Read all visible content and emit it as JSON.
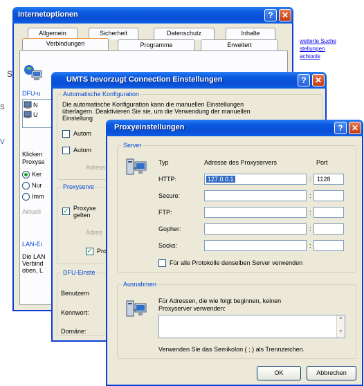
{
  "background": {
    "left_letters": [
      "S",
      "S",
      "V"
    ],
    "links": [
      "weiterte Suche",
      "stellungen",
      "achtools"
    ]
  },
  "inet": {
    "title": "Internetoptionen",
    "tabs_row1": [
      "Allgemein",
      "Sicherheit",
      "Datenschutz",
      "Inhalte"
    ],
    "tabs_row2": [
      "Verbindungen",
      "Programme",
      "Erweitert"
    ],
    "dfu_label": "DFU-u",
    "list_items": [
      "N",
      "U"
    ],
    "klicken": "Klicken",
    "proxyse": "Proxyse",
    "radios": [
      "Ker",
      "Nur",
      "Imm"
    ],
    "aktuell": "Aktuell",
    "lan_label": "LAN-Ei",
    "lan_text": [
      "Die LAN",
      "Verbind",
      "oben, L"
    ]
  },
  "umts": {
    "title": "UMTS bevorzugt Connection Einstellungen",
    "auto_group": "Automatische Konfiguration",
    "auto_text": [
      "Die automatische Konfiguration kann die manuellen Einstellungen",
      "überlagern. Deaktivieren Sie sie, um die Verwendung der manuellen",
      "Einstellung"
    ],
    "auto_cb1": "Autom",
    "auto_cb2": "Autom",
    "adress": "Adress",
    "proxy_group": "Proxyserve",
    "proxy_cb": [
      "Proxyse",
      "gelten"
    ],
    "adress2": "Adres",
    "pro_cb": "Pro",
    "dfu_group": "DFU-Einste",
    "benutzer": "Benutzern",
    "kennwort": "Kennwort:",
    "domaene": "Domäne:"
  },
  "proxy": {
    "title": "Proxyeinstellungen",
    "server_group": "Server",
    "col_typ": "Typ",
    "col_addr": "Adresse des Proxyservers",
    "col_port": "Port",
    "rows": [
      {
        "label": "HTTP:",
        "addr": "127.0.0.1",
        "port": "1128"
      },
      {
        "label": "Secure:",
        "addr": "",
        "port": ""
      },
      {
        "label": "FTP:",
        "addr": "",
        "port": ""
      },
      {
        "label": "Gopher:",
        "addr": "",
        "port": ""
      },
      {
        "label": "Socks:",
        "addr": "",
        "port": ""
      }
    ],
    "colon": ":",
    "same_proxy": "Für alle Protokolle denselben Server verwenden",
    "exc_group": "Ausnahmen",
    "exc_text1": "Für Adressen, die wie folgt beginnen, keinen",
    "exc_text2": "Proxyserver verwenden:",
    "exc_value": "",
    "exc_hint": "Verwenden Sie das Semikolon ( ; ) als Trennzeichen.",
    "ok": "OK",
    "cancel": "Abbrechen"
  },
  "colors": {
    "title_blue": "#0a4fd4",
    "dialog_bg": "#ece9d8",
    "group_label": "#0046d5",
    "selection": "#316ac5"
  }
}
